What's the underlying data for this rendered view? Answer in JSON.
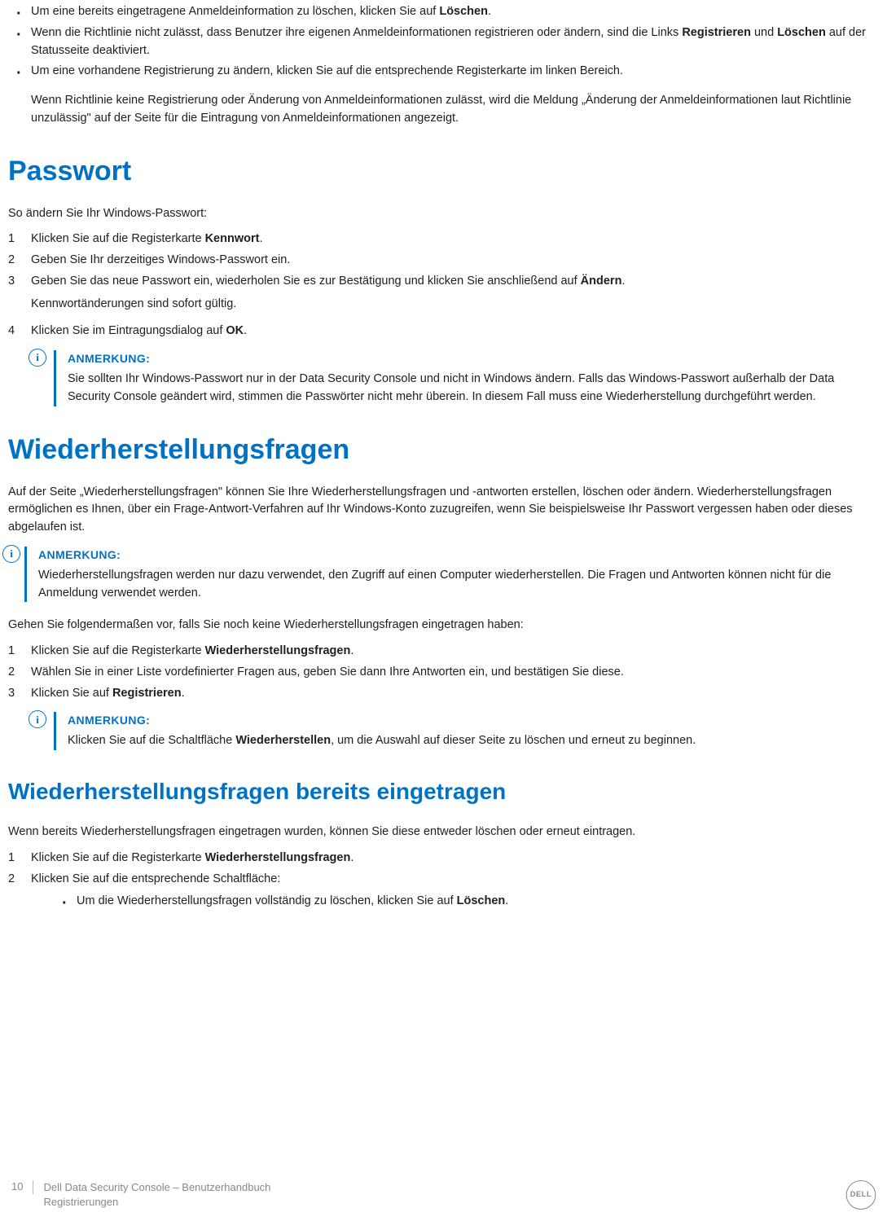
{
  "intro_bullets": {
    "b1_pre": "Um eine bereits eingetragene Anmeldeinformation zu löschen, klicken Sie auf ",
    "b1_bold": "Löschen",
    "b1_post": ".",
    "b2_pre": "Wenn die Richtlinie nicht zulässt, dass Benutzer ihre eigenen Anmeldeinformationen registrieren oder ändern, sind die Links ",
    "b2_bold1": "Registrieren",
    "b2_mid": " und ",
    "b2_bold2": "Löschen",
    "b2_post": " auf der Statusseite deaktiviert.",
    "b3": "Um eine vorhandene Registrierung zu ändern, klicken Sie auf die entsprechende Registerkarte im linken Bereich.",
    "after": "Wenn Richtlinie keine Registrierung oder Änderung von Anmeldeinformationen zulässt, wird die Meldung „Änderung der Anmeldeinformationen laut Richtlinie unzulässig\" auf der Seite für die Eintragung von Anmeldeinformationen angezeigt."
  },
  "passwort": {
    "heading": "Passwort",
    "intro": "So ändern Sie Ihr Windows-Passwort:",
    "steps": {
      "s1_pre": "Klicken Sie auf die Registerkarte ",
      "s1_bold": "Kennwort",
      "s1_post": ".",
      "s2": "Geben Sie Ihr derzeitiges Windows-Passwort ein.",
      "s3_pre": "Geben Sie das neue Passwort ein, wiederholen Sie es zur Bestätigung und klicken Sie anschließend auf ",
      "s3_bold": "Ändern",
      "s3_post": ".",
      "s3_cont": "Kennwortänderungen sind sofort gültig.",
      "s4_pre": "Klicken Sie im Eintragungsdialog auf ",
      "s4_bold": "OK",
      "s4_post": "."
    },
    "note_head": "ANMERKUNG:",
    "note_body": "Sie sollten Ihr Windows-Passwort nur in der Data Security Console und nicht in Windows ändern. Falls das Windows-Passwort außerhalb der Data Security Console geändert wird, stimmen die Passwörter nicht mehr überein. In diesem Fall muss eine Wiederherstellung durchgeführt werden."
  },
  "recovery": {
    "heading": "Wiederherstellungsfragen",
    "intro": "Auf der Seite „Wiederherstellungsfragen\" können Sie Ihre Wiederherstellungsfragen und -antworten erstellen, löschen oder ändern. Wiederherstellungsfragen ermöglichen es Ihnen, über ein Frage-Antwort-Verfahren auf Ihr Windows-Konto zuzugreifen, wenn Sie beispielsweise Ihr Passwort vergessen haben oder dieses abgelaufen ist.",
    "note1_head": "ANMERKUNG:",
    "note1_body": "Wiederherstellungsfragen werden nur dazu verwendet, den Zugriff auf einen Computer wiederherstellen. Die Fragen und Antworten können nicht für die Anmeldung verwendet werden.",
    "lead": "Gehen Sie folgendermaßen vor, falls Sie noch keine Wiederherstellungsfragen eingetragen haben:",
    "steps": {
      "s1_pre": "Klicken Sie auf die Registerkarte ",
      "s1_bold": "Wiederherstellungsfragen",
      "s1_post": ".",
      "s2": "Wählen Sie in einer Liste vordefinierter Fragen aus, geben Sie dann Ihre Antworten ein, und bestätigen Sie diese.",
      "s3_pre": "Klicken Sie auf ",
      "s3_bold": "Registrieren",
      "s3_post": "."
    },
    "note2_head": "ANMERKUNG:",
    "note2_pre": "Klicken Sie auf die Schaltfläche ",
    "note2_bold": "Wiederherstellen",
    "note2_post": ", um die Auswahl auf dieser Seite zu löschen und erneut zu beginnen."
  },
  "recovery2": {
    "heading": "Wiederherstellungsfragen bereits eingetragen",
    "intro": "Wenn bereits Wiederherstellungsfragen eingetragen wurden, können Sie diese entweder löschen oder erneut eintragen.",
    "steps": {
      "s1_pre": "Klicken Sie auf die Registerkarte ",
      "s1_bold": "Wiederherstellungsfragen",
      "s1_post": ".",
      "s2": "Klicken Sie auf die entsprechende Schaltfläche:",
      "sub_pre": "Um die Wiederherstellungsfragen vollständig zu löschen, klicken Sie auf ",
      "sub_bold": "Löschen",
      "sub_post": "."
    }
  },
  "footer": {
    "page": "10",
    "title": "Dell Data Security Console – Benutzerhandbuch",
    "section": "Registrierungen",
    "logo": "DELL"
  }
}
